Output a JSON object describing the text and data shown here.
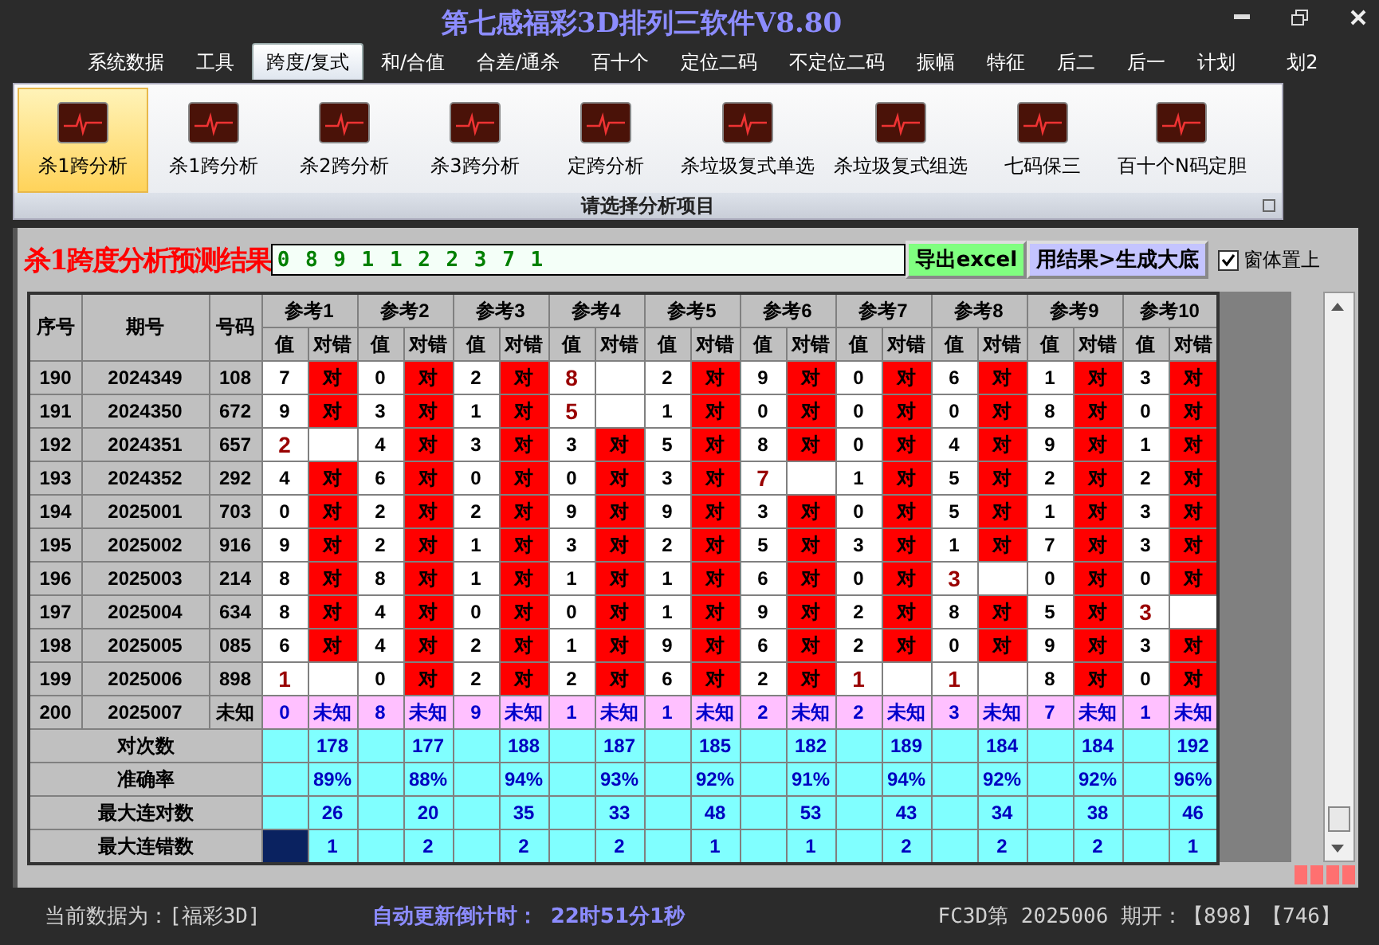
{
  "window": {
    "title": "第七感福彩3D排列三软件V8.80"
  },
  "menu": [
    {
      "label": "系统数据",
      "selected": false
    },
    {
      "label": "工具",
      "selected": false
    },
    {
      "label": "跨度/复式",
      "selected": true
    },
    {
      "label": "和/合值",
      "selected": false
    },
    {
      "label": "合差/通杀",
      "selected": false
    },
    {
      "label": "百十个",
      "selected": false
    },
    {
      "label": "定位二码",
      "selected": false
    },
    {
      "label": "不定位二码",
      "selected": false
    },
    {
      "label": "振幅",
      "selected": false
    },
    {
      "label": "特征",
      "selected": false
    },
    {
      "label": "后二",
      "selected": false
    },
    {
      "label": "后一",
      "selected": false
    },
    {
      "label": "计划",
      "selected": false
    },
    {
      "label": "划2",
      "selected": false
    }
  ],
  "ribbon": {
    "group_label": "请选择分析项目",
    "items": [
      {
        "label": "杀1跨分析",
        "selected": true
      },
      {
        "label": "杀1跨分析",
        "selected": false
      },
      {
        "label": "杀2跨分析",
        "selected": false
      },
      {
        "label": "杀3跨分析",
        "selected": false
      },
      {
        "label": "定跨分析",
        "selected": false
      },
      {
        "label": "杀垃圾复式单选",
        "selected": false
      },
      {
        "label": "杀垃圾复式组选",
        "selected": false
      },
      {
        "label": "七码保三",
        "selected": false
      },
      {
        "label": "百十个N码定胆",
        "selected": false
      }
    ]
  },
  "analysis": {
    "title": "杀1跨度分析预测结果",
    "prediction": "0 8 9 1 1 2 2 3 7 1",
    "buttons": [
      {
        "label": "导出excel",
        "kind": "export"
      },
      {
        "label": "用结果>生成大底",
        "kind": "generate"
      }
    ],
    "stay_on_top": {
      "label": "窗体置上",
      "checked": true
    }
  },
  "table": {
    "columns": [
      "序号",
      "期号",
      "号码"
    ],
    "refs": [
      {
        "label": "参考1",
        "value_header": "值",
        "result_header": "对错"
      },
      {
        "label": "参考2",
        "value_header": "值",
        "result_header": "对错"
      },
      {
        "label": "参考3",
        "value_header": "值",
        "result_header": "对错"
      },
      {
        "label": "参考4",
        "value_header": "值",
        "result_header": "对错"
      },
      {
        "label": "参考5",
        "value_header": "值",
        "result_header": "对错"
      },
      {
        "label": "参考6",
        "value_header": "值",
        "result_header": "对错"
      },
      {
        "label": "参考7",
        "value_header": "值",
        "result_header": "对错"
      },
      {
        "label": "参考8",
        "value_header": "值",
        "result_header": "对错"
      },
      {
        "label": "参考9",
        "value_header": "值",
        "result_header": "对错"
      },
      {
        "label": "参考10",
        "value_header": "值",
        "result_header": "对错"
      }
    ],
    "rows": [
      {
        "kind": "history",
        "no": "190",
        "issue": "2024349",
        "number": "108",
        "refs": [
          {
            "value": "7",
            "hit": true,
            "result": "对"
          },
          {
            "value": "0",
            "hit": true,
            "result": "对"
          },
          {
            "value": "2",
            "hit": true,
            "result": "对"
          },
          {
            "value": "8",
            "hit": false
          },
          {
            "value": "2",
            "hit": true,
            "result": "对"
          },
          {
            "value": "9",
            "hit": true,
            "result": "对"
          },
          {
            "value": "0",
            "hit": true,
            "result": "对"
          },
          {
            "value": "6",
            "hit": true,
            "result": "对"
          },
          {
            "value": "1",
            "hit": true,
            "result": "对"
          },
          {
            "value": "3",
            "hit": true,
            "result": "对"
          }
        ]
      },
      {
        "kind": "history",
        "no": "191",
        "issue": "2024350",
        "number": "672",
        "refs": [
          {
            "value": "9",
            "hit": true,
            "result": "对"
          },
          {
            "value": "3",
            "hit": true,
            "result": "对"
          },
          {
            "value": "1",
            "hit": true,
            "result": "对"
          },
          {
            "value": "5",
            "hit": false
          },
          {
            "value": "1",
            "hit": true,
            "result": "对"
          },
          {
            "value": "0",
            "hit": true,
            "result": "对"
          },
          {
            "value": "0",
            "hit": true,
            "result": "对"
          },
          {
            "value": "0",
            "hit": true,
            "result": "对"
          },
          {
            "value": "8",
            "hit": true,
            "result": "对"
          },
          {
            "value": "0",
            "hit": true,
            "result": "对"
          }
        ]
      },
      {
        "kind": "history",
        "no": "192",
        "issue": "2024351",
        "number": "657",
        "refs": [
          {
            "value": "2",
            "hit": false
          },
          {
            "value": "4",
            "hit": true,
            "result": "对"
          },
          {
            "value": "3",
            "hit": true,
            "result": "对"
          },
          {
            "value": "3",
            "hit": true,
            "result": "对"
          },
          {
            "value": "5",
            "hit": true,
            "result": "对"
          },
          {
            "value": "8",
            "hit": true,
            "result": "对"
          },
          {
            "value": "0",
            "hit": true,
            "result": "对"
          },
          {
            "value": "4",
            "hit": true,
            "result": "对"
          },
          {
            "value": "9",
            "hit": true,
            "result": "对"
          },
          {
            "value": "1",
            "hit": true,
            "result": "对"
          }
        ]
      },
      {
        "kind": "history",
        "no": "193",
        "issue": "2024352",
        "number": "292",
        "refs": [
          {
            "value": "4",
            "hit": true,
            "result": "对"
          },
          {
            "value": "6",
            "hit": true,
            "result": "对"
          },
          {
            "value": "0",
            "hit": true,
            "result": "对"
          },
          {
            "value": "0",
            "hit": true,
            "result": "对"
          },
          {
            "value": "3",
            "hit": true,
            "result": "对"
          },
          {
            "value": "7",
            "hit": false
          },
          {
            "value": "1",
            "hit": true,
            "result": "对"
          },
          {
            "value": "5",
            "hit": true,
            "result": "对"
          },
          {
            "value": "2",
            "hit": true,
            "result": "对"
          },
          {
            "value": "2",
            "hit": true,
            "result": "对"
          }
        ]
      },
      {
        "kind": "history",
        "no": "194",
        "issue": "2025001",
        "number": "703",
        "refs": [
          {
            "value": "0",
            "hit": true,
            "result": "对"
          },
          {
            "value": "2",
            "hit": true,
            "result": "对"
          },
          {
            "value": "2",
            "hit": true,
            "result": "对"
          },
          {
            "value": "9",
            "hit": true,
            "result": "对"
          },
          {
            "value": "9",
            "hit": true,
            "result": "对"
          },
          {
            "value": "3",
            "hit": true,
            "result": "对"
          },
          {
            "value": "0",
            "hit": true,
            "result": "对"
          },
          {
            "value": "5",
            "hit": true,
            "result": "对"
          },
          {
            "value": "1",
            "hit": true,
            "result": "对"
          },
          {
            "value": "3",
            "hit": true,
            "result": "对"
          }
        ]
      },
      {
        "kind": "history",
        "no": "195",
        "issue": "2025002",
        "number": "916",
        "refs": [
          {
            "value": "9",
            "hit": true,
            "result": "对"
          },
          {
            "value": "2",
            "hit": true,
            "result": "对"
          },
          {
            "value": "1",
            "hit": true,
            "result": "对"
          },
          {
            "value": "3",
            "hit": true,
            "result": "对"
          },
          {
            "value": "2",
            "hit": true,
            "result": "对"
          },
          {
            "value": "5",
            "hit": true,
            "result": "对"
          },
          {
            "value": "3",
            "hit": true,
            "result": "对"
          },
          {
            "value": "1",
            "hit": true,
            "result": "对"
          },
          {
            "value": "7",
            "hit": true,
            "result": "对"
          },
          {
            "value": "3",
            "hit": true,
            "result": "对"
          }
        ]
      },
      {
        "kind": "history",
        "no": "196",
        "issue": "2025003",
        "number": "214",
        "refs": [
          {
            "value": "8",
            "hit": true,
            "result": "对"
          },
          {
            "value": "8",
            "hit": true,
            "result": "对"
          },
          {
            "value": "1",
            "hit": true,
            "result": "对"
          },
          {
            "value": "1",
            "hit": true,
            "result": "对"
          },
          {
            "value": "1",
            "hit": true,
            "result": "对"
          },
          {
            "value": "6",
            "hit": true,
            "result": "对"
          },
          {
            "value": "0",
            "hit": true,
            "result": "对"
          },
          {
            "value": "3",
            "hit": false
          },
          {
            "value": "0",
            "hit": true,
            "result": "对"
          },
          {
            "value": "0",
            "hit": true,
            "result": "对"
          }
        ]
      },
      {
        "kind": "history",
        "no": "197",
        "issue": "2025004",
        "number": "634",
        "refs": [
          {
            "value": "8",
            "hit": true,
            "result": "对"
          },
          {
            "value": "4",
            "hit": true,
            "result": "对"
          },
          {
            "value": "0",
            "hit": true,
            "result": "对"
          },
          {
            "value": "0",
            "hit": true,
            "result": "对"
          },
          {
            "value": "1",
            "hit": true,
            "result": "对"
          },
          {
            "value": "9",
            "hit": true,
            "result": "对"
          },
          {
            "value": "2",
            "hit": true,
            "result": "对"
          },
          {
            "value": "8",
            "hit": true,
            "result": "对"
          },
          {
            "value": "5",
            "hit": true,
            "result": "对"
          },
          {
            "value": "3",
            "hit": false
          }
        ]
      },
      {
        "kind": "history",
        "no": "198",
        "issue": "2025005",
        "number": "085",
        "refs": [
          {
            "value": "6",
            "hit": true,
            "result": "对"
          },
          {
            "value": "4",
            "hit": true,
            "result": "对"
          },
          {
            "value": "2",
            "hit": true,
            "result": "对"
          },
          {
            "value": "1",
            "hit": true,
            "result": "对"
          },
          {
            "value": "9",
            "hit": true,
            "result": "对"
          },
          {
            "value": "6",
            "hit": true,
            "result": "对"
          },
          {
            "value": "2",
            "hit": true,
            "result": "对"
          },
          {
            "value": "0",
            "hit": true,
            "result": "对"
          },
          {
            "value": "9",
            "hit": true,
            "result": "对"
          },
          {
            "value": "3",
            "hit": true,
            "result": "对"
          }
        ]
      },
      {
        "kind": "history",
        "no": "199",
        "issue": "2025006",
        "number": "898",
        "refs": [
          {
            "value": "1",
            "hit": false
          },
          {
            "value": "0",
            "hit": true,
            "result": "对"
          },
          {
            "value": "2",
            "hit": true,
            "result": "对"
          },
          {
            "value": "2",
            "hit": true,
            "result": "对"
          },
          {
            "value": "6",
            "hit": true,
            "result": "对"
          },
          {
            "value": "2",
            "hit": true,
            "result": "对"
          },
          {
            "value": "1",
            "hit": false
          },
          {
            "value": "1",
            "hit": false
          },
          {
            "value": "8",
            "hit": true,
            "result": "对"
          },
          {
            "value": "0",
            "hit": true,
            "result": "对"
          }
        ]
      },
      {
        "kind": "forecast",
        "no": "200",
        "issue": "2025007",
        "number": "未知",
        "refs": [
          {
            "value": "0",
            "result": "未知"
          },
          {
            "value": "8",
            "result": "未知"
          },
          {
            "value": "9",
            "result": "未知"
          },
          {
            "value": "1",
            "result": "未知"
          },
          {
            "value": "1",
            "result": "未知"
          },
          {
            "value": "2",
            "result": "未知"
          },
          {
            "value": "2",
            "result": "未知"
          },
          {
            "value": "3",
            "result": "未知"
          },
          {
            "value": "7",
            "result": "未知"
          },
          {
            "value": "1",
            "result": "未知"
          }
        ]
      }
    ],
    "summary": [
      {
        "label": "对次数",
        "cells": [
          {
            "text": "178",
            "selected": false
          },
          {
            "text": "177",
            "selected": false
          },
          {
            "text": "188",
            "selected": false
          },
          {
            "text": "187",
            "selected": false
          },
          {
            "text": "185",
            "selected": false
          },
          {
            "text": "182",
            "selected": false
          },
          {
            "text": "189",
            "selected": false
          },
          {
            "text": "184",
            "selected": false
          },
          {
            "text": "184",
            "selected": false
          },
          {
            "text": "192",
            "selected": false
          }
        ]
      },
      {
        "label": "准确率",
        "cells": [
          {
            "text": "89%",
            "selected": false
          },
          {
            "text": "88%",
            "selected": false
          },
          {
            "text": "94%",
            "selected": false
          },
          {
            "text": "93%",
            "selected": false
          },
          {
            "text": "92%",
            "selected": false
          },
          {
            "text": "91%",
            "selected": false
          },
          {
            "text": "94%",
            "selected": false
          },
          {
            "text": "92%",
            "selected": false
          },
          {
            "text": "92%",
            "selected": false
          },
          {
            "text": "96%",
            "selected": false
          }
        ]
      },
      {
        "label": "最大连对数",
        "cells": [
          {
            "text": "26",
            "selected": false
          },
          {
            "text": "20",
            "selected": false
          },
          {
            "text": "35",
            "selected": false
          },
          {
            "text": "33",
            "selected": false
          },
          {
            "text": "48",
            "selected": false
          },
          {
            "text": "53",
            "selected": false
          },
          {
            "text": "43",
            "selected": false
          },
          {
            "text": "34",
            "selected": false
          },
          {
            "text": "38",
            "selected": false
          },
          {
            "text": "46",
            "selected": false
          }
        ]
      },
      {
        "label": "最大连错数",
        "cells": [
          {
            "text": "1",
            "selected": true
          },
          {
            "text": "2",
            "selected": false
          },
          {
            "text": "2",
            "selected": false
          },
          {
            "text": "2",
            "selected": false
          },
          {
            "text": "1",
            "selected": false
          },
          {
            "text": "1",
            "selected": false
          },
          {
            "text": "2",
            "selected": false
          },
          {
            "text": "2",
            "selected": false
          },
          {
            "text": "2",
            "selected": false
          },
          {
            "text": "1",
            "selected": false
          }
        ]
      }
    ]
  },
  "status_bar": {
    "data_source": "当前数据为：[福彩3D]",
    "countdown_label": "自动更新倒计时：",
    "countdown": "22时51分1秒",
    "latest_draw": "FC3D第 2025006 期开：【898】【746】"
  }
}
